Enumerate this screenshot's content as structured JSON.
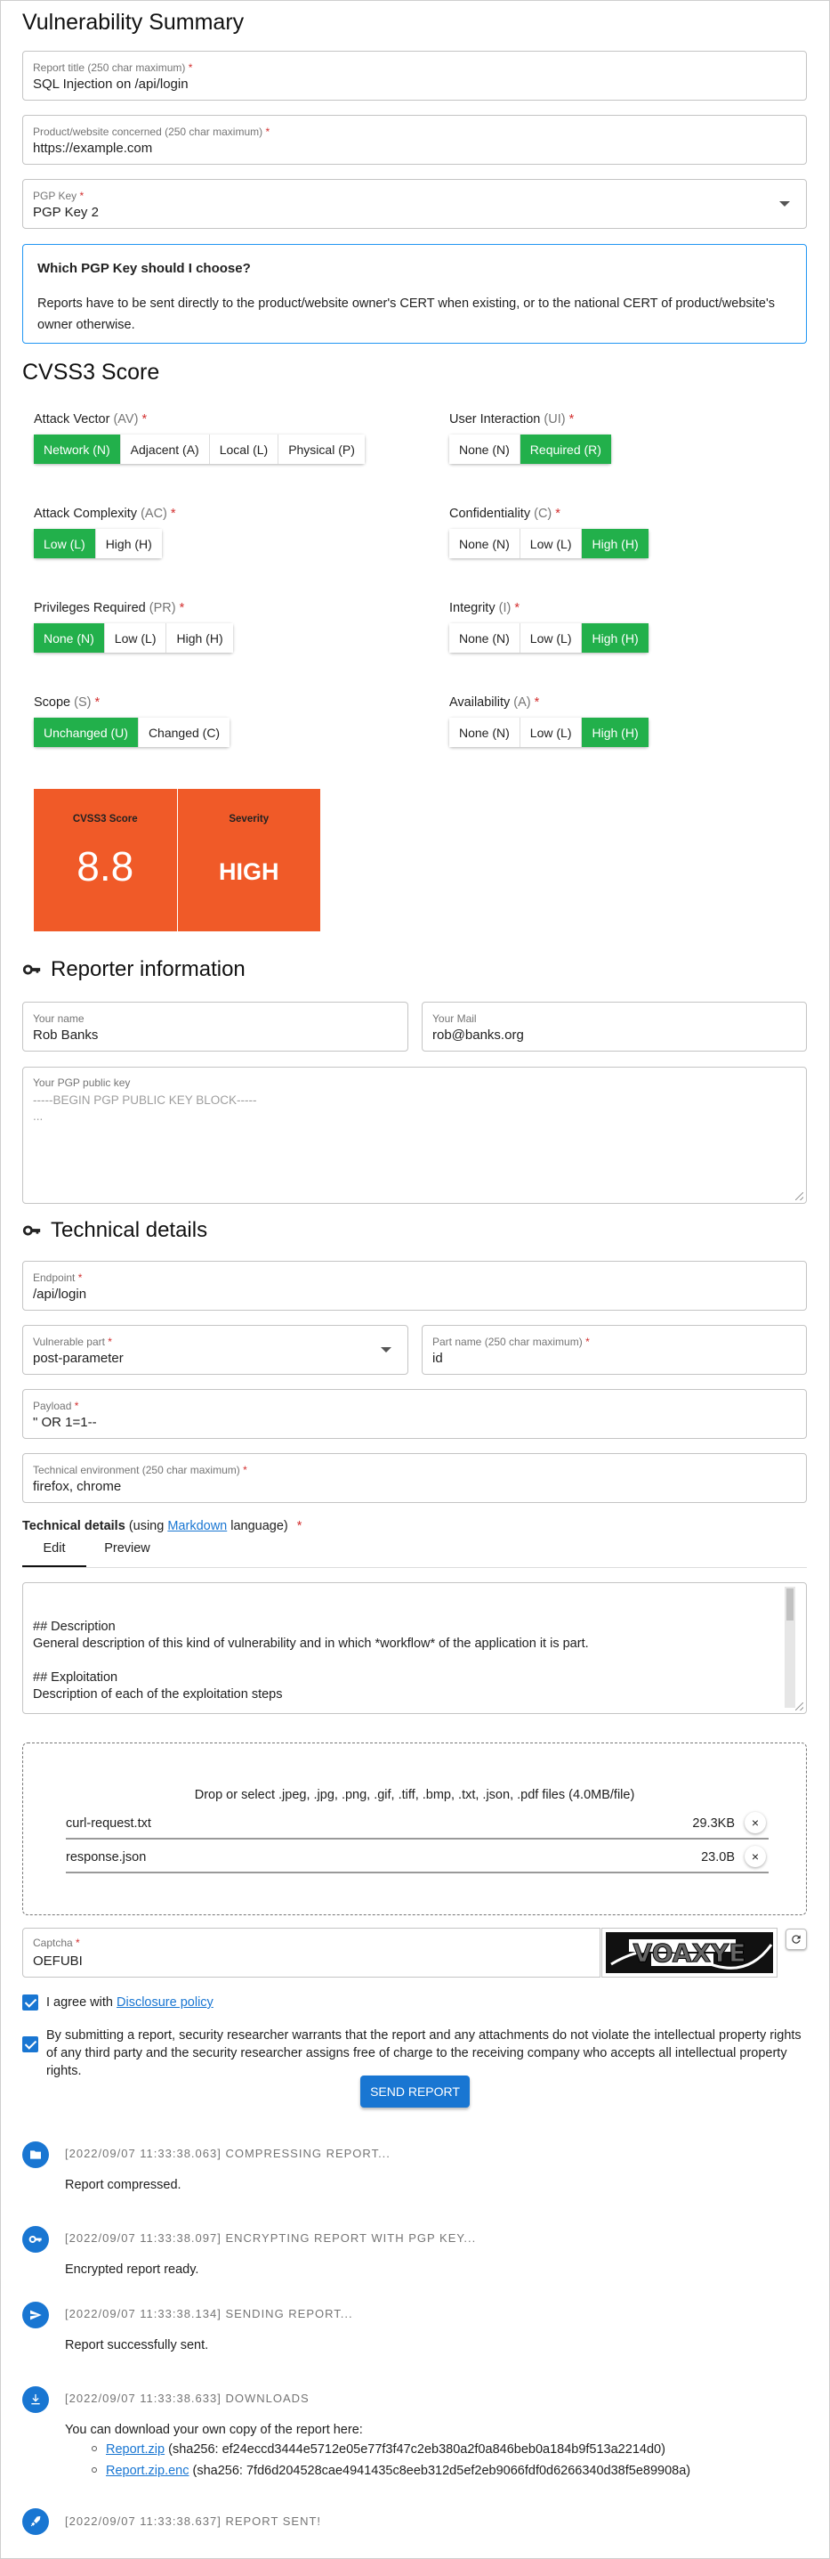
{
  "summary": {
    "heading": "Vulnerability Summary",
    "title_label": "Report title (250 char maximum)",
    "title_value": "SQL Injection on /api/login",
    "product_label": "Product/website concerned (250 char maximum)",
    "product_value": "https://example.com",
    "pgp_label": "PGP Key",
    "pgp_value": "PGP Key 2",
    "req": "*",
    "info_title": "Which PGP Key should I choose?",
    "info_body": "Reports have to be sent directly to the product/website owner's CERT when existing, or to the national CERT of product/website's owner otherwise."
  },
  "cvss": {
    "heading": "CVSS3 Score",
    "metrics": [
      {
        "name": "Attack Vector",
        "abbr": "(AV)",
        "options": [
          "Network (N)",
          "Adjacent (A)",
          "Local (L)",
          "Physical (P)"
        ],
        "selected": 0
      },
      {
        "name": "User Interaction",
        "abbr": "(UI)",
        "options": [
          "None (N)",
          "Required (R)"
        ],
        "selected": 1
      },
      {
        "name": "Attack Complexity",
        "abbr": "(AC)",
        "options": [
          "Low (L)",
          "High (H)"
        ],
        "selected": 0
      },
      {
        "name": "Confidentiality",
        "abbr": "(C)",
        "options": [
          "None (N)",
          "Low (L)",
          "High (H)"
        ],
        "selected": 2
      },
      {
        "name": "Privileges Required",
        "abbr": "(PR)",
        "options": [
          "None (N)",
          "Low (L)",
          "High (H)"
        ],
        "selected": 0
      },
      {
        "name": "Integrity",
        "abbr": "(I)",
        "options": [
          "None (N)",
          "Low (L)",
          "High (H)"
        ],
        "selected": 2
      },
      {
        "name": "Scope",
        "abbr": "(S)",
        "options": [
          "Unchanged (U)",
          "Changed (C)"
        ],
        "selected": 0
      },
      {
        "name": "Availability",
        "abbr": "(A)",
        "options": [
          "None (N)",
          "Low (L)",
          "High (H)"
        ],
        "selected": 2
      }
    ],
    "score_label": "CVSS3 Score",
    "score_value": "8.8",
    "severity_label": "Severity",
    "severity_value": "HIGH",
    "score_color": "#f05a28",
    "selected_color": "#22b04b"
  },
  "reporter": {
    "heading": "Reporter information",
    "icon": "key-icon",
    "name_label": "Your name",
    "name_value": "Rob Banks",
    "mail_label": "Your Mail",
    "mail_value": "rob@banks.org",
    "pgp_label": "Your PGP public key",
    "pgp_placeholder": "-----BEGIN PGP PUBLIC KEY BLOCK-----\n..."
  },
  "technical": {
    "heading": "Technical details",
    "icon": "key-icon",
    "endpoint_label": "Endpoint",
    "endpoint_value": "/api/login",
    "vuln_part_label": "Vulnerable part",
    "vuln_part_value": "post-parameter",
    "part_name_label": "Part name (250 char maximum)",
    "part_name_value": "id",
    "payload_label": "Payload",
    "payload_value": "\" OR 1=1--",
    "env_label": "Technical environment (250 char maximum)",
    "env_value": "firefox, chrome",
    "details_label": "Technical details",
    "details_using": "(using",
    "details_link": "Markdown",
    "details_lang": "language)",
    "tabs": [
      "Edit",
      "Preview"
    ],
    "editor_text": "## Description\nGeneral description of this kind of vulnerability and in which *workflow* of the application it is part.\n\n## Exploitation\nDescription of each of the exploitation steps\n\n## PoC"
  },
  "upload": {
    "instructions": "Drop or select .jpeg, .jpg, .png, .gif, .tiff, .bmp, .txt, .json, .pdf files (4.0MB/file)",
    "files": [
      {
        "name": "curl-request.txt",
        "size": "29.3KB"
      },
      {
        "name": "response.json",
        "size": "23.0B"
      }
    ],
    "remove_glyph": "×"
  },
  "captcha": {
    "label": "Captcha",
    "value": "OEFUBI",
    "image_text": "VOAXYE"
  },
  "agreements": {
    "policy_prefix": "I agree with",
    "policy_link": "Disclosure policy",
    "warranty": "By submitting a report, security researcher warrants that the report and any attachments do not violate the intellectual property rights of any third party and the security researcher assigns free of charge to the receiving company who accepts all intellectual property rights."
  },
  "send_button": "SEND REPORT",
  "timeline": [
    {
      "icon": "folder-icon",
      "header": "[2022/09/07 11:33:38.063] COMPRESSING REPORT...",
      "body": "Report compressed."
    },
    {
      "icon": "key-icon",
      "header": "[2022/09/07 11:33:38.097] ENCRYPTING REPORT WITH PGP KEY...",
      "body": "Encrypted report ready."
    },
    {
      "icon": "send-icon",
      "header": "[2022/09/07 11:33:38.134] SENDING REPORT...",
      "body": "Report successfully sent."
    },
    {
      "icon": "download-icon",
      "header": "[2022/09/07 11:33:38.633] DOWNLOADS",
      "body": "You can download your own copy of the report here:"
    },
    {
      "icon": "rocket-icon",
      "header": "[2022/09/07 11:33:38.637] REPORT SENT!",
      "body": ""
    }
  ],
  "downloads": [
    {
      "link": "Report.zip",
      "hash": "(sha256: ef24eccd3444e5712e05e77f3f47c2eb380a2f0a846beb0a184b9f513a2214d0)"
    },
    {
      "link": "Report.zip.enc",
      "hash": "(sha256: 7fd6d204528cae4941435c8eeb312d5ef2eb9066fdf0d6266340d38f5e89908a)"
    }
  ]
}
